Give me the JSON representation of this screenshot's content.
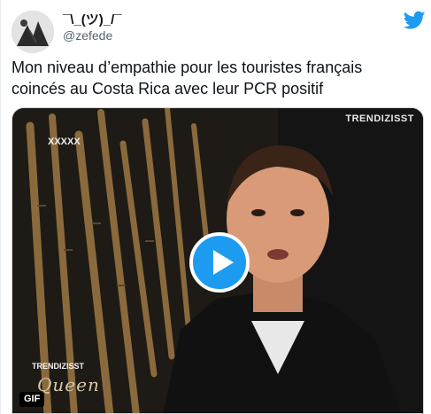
{
  "user": {
    "display_name": "¯\\_(ツ)_/¯",
    "handle": "@zefede",
    "avatar_icon": "user-avatar"
  },
  "tweet": {
    "text": "Mon niveau d’empathie pour les touristes français\ncoincés au Costa Rica avec leur PCR positif"
  },
  "media": {
    "type": "gif",
    "badge": "GIF",
    "watermark_top": "TRENDIZISST",
    "watermark_left": "XXXXX",
    "show_logo_brand": "TRENDIZISST",
    "show_logo_script": "Queen",
    "play_icon": "play-icon"
  },
  "colors": {
    "accent": "#1d9bf0",
    "text_primary": "#0f1419",
    "text_secondary": "#536471"
  }
}
